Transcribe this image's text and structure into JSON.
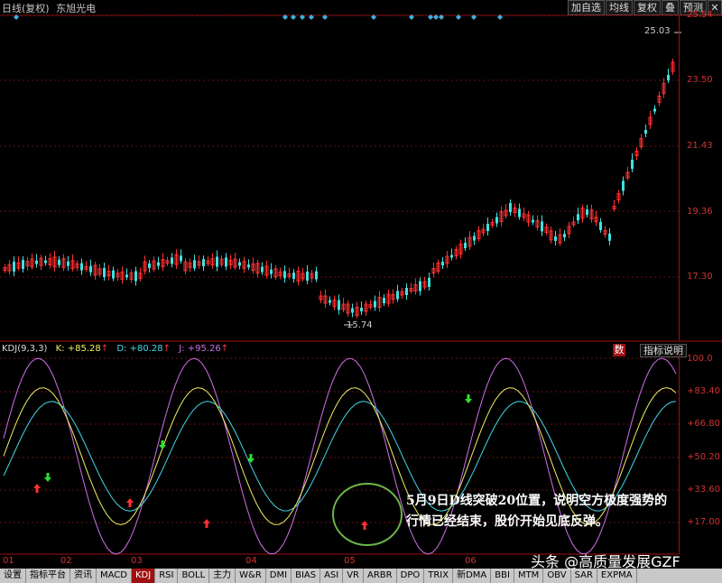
{
  "header": {
    "period": "日线(复权)",
    "stock_name": "东旭光电",
    "toolbar": [
      "加自选",
      "均线",
      "复权",
      "叠",
      "预测"
    ],
    "close_glyph": "✕"
  },
  "price_panel": {
    "axis_ticks": [
      "25.54",
      "23.50",
      "21.43",
      "19.36",
      "17.30"
    ],
    "high_label": "25.03",
    "low_label": "15.74"
  },
  "kdj_panel": {
    "name": "KDJ(9,3,3)",
    "k_label": "K: +85.28",
    "d_label": "D: +80.28",
    "j_label": "J: +95.26",
    "num_button": "数",
    "explain_button": "指标说明",
    "axis_ticks": [
      "100.0",
      "+83.40",
      "+66.80",
      "+50.20",
      "+33.60",
      "+17.00"
    ],
    "colors": {
      "k": "#f0f060",
      "d": "#40d8e8",
      "j": "#d070e8"
    }
  },
  "months": [
    "01",
    "02",
    "03",
    "04",
    "05",
    "06"
  ],
  "annotation": "5月9日D线突破20位置，说明空方极度强势的行情已经结束，股价开始见底反弹。",
  "watermark": "头条 @高质量发展GZF",
  "bottom_tabs": [
    "设置",
    "指标平台",
    "资讯",
    "MACD",
    "KDJ",
    "RSI",
    "BOLL",
    "主力",
    "W&R",
    "DMI",
    "BIAS",
    "ASI",
    "VR",
    "ARBR",
    "DPO",
    "TRIX",
    "新DMA",
    "BBI",
    "MTM",
    "OBV",
    "SAR",
    "EXPMA"
  ],
  "active_tab": "KDJ"
}
